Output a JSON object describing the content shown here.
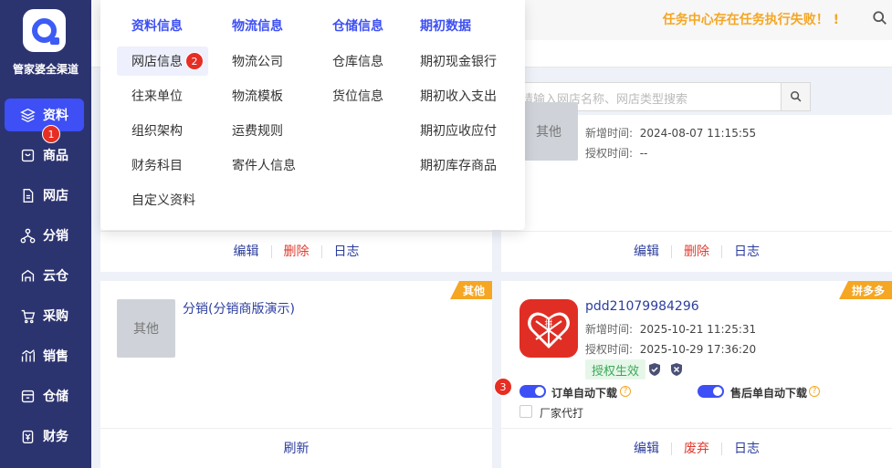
{
  "brand": {
    "name": "管家婆全渠道"
  },
  "sidebar": {
    "items": [
      {
        "label": "资料",
        "icon": "layers-icon",
        "active": true
      },
      {
        "label": "商品",
        "icon": "product-box-icon"
      },
      {
        "label": "网店",
        "icon": "document-icon"
      },
      {
        "label": "分销",
        "icon": "org-tree-icon"
      },
      {
        "label": "云仓",
        "icon": "cloud-warehouse-icon"
      },
      {
        "label": "采购",
        "icon": "cart-icon"
      },
      {
        "label": "销售",
        "icon": "sales-chart-icon"
      },
      {
        "label": "仓储",
        "icon": "storage-box-icon"
      },
      {
        "label": "财务",
        "icon": "finance-icon"
      }
    ]
  },
  "header": {
    "notice": "任务中心存在任务执行失败！ !"
  },
  "search": {
    "placeholder": "请输入网店名称、网店类型搜索"
  },
  "menu": {
    "columns": [
      {
        "title": "资料信息",
        "items": [
          "网店信息",
          "往来单位",
          "组织架构",
          "财务科目",
          "自定义资料"
        ]
      },
      {
        "title": "物流信息",
        "items": [
          "物流公司",
          "物流模板",
          "运费规则",
          "寄件人信息"
        ]
      },
      {
        "title": "仓储信息",
        "items": [
          "仓库信息",
          "货位信息"
        ]
      },
      {
        "title": "期初数据",
        "items": [
          "期初现金银行",
          "期初收入支出",
          "期初应收应付",
          "期初库存商品"
        ]
      }
    ]
  },
  "cards": {
    "top_left": {
      "actions": [
        "编辑",
        "删除",
        "日志"
      ]
    },
    "top_right": {
      "thumb": "其他",
      "added_label": "新增时间:",
      "added": "2024-08-07 11:15:55",
      "auth_label": "授权时间:",
      "auth": "--",
      "actions": [
        "编辑",
        "删除",
        "日志"
      ]
    },
    "bottom_left": {
      "tag": "其他",
      "thumb": "其他",
      "name": "分销(分销商版演示)",
      "actions": [
        "刷新"
      ]
    },
    "bottom_right": {
      "tag": "拼多多",
      "name": "pdd21079984296",
      "added_label": "新增时间:",
      "added": "2025-10-21 11:25:31",
      "auth_label": "授权时间:",
      "auth": "2025-10-29 17:36:20",
      "status": "授权生效",
      "toggle1": "订单自动下载",
      "toggle2": "售后单自动下载",
      "checkbox": "厂家代打",
      "actions": [
        "编辑",
        "废弃",
        "日志"
      ]
    }
  },
  "badges": [
    "1",
    "2",
    "3"
  ],
  "colors": {
    "sidebar": "#2c3470",
    "accent": "#3d4ff5",
    "warning": "#f5a623",
    "danger": "#e62e24"
  }
}
